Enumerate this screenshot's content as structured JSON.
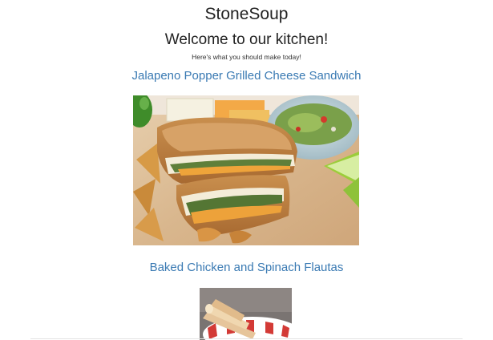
{
  "site": {
    "title": "StoneSoup",
    "welcome": "Welcome to our kitchen!",
    "tagline": "Here's what you should make today!"
  },
  "recipes": [
    {
      "title": "Jalapeno Popper Grilled Cheese Sandwich",
      "image_subject": "grilled cheese sandwich halves with jalapeno and guacamole"
    },
    {
      "title": "Baked Chicken and Spinach Flautas",
      "image_subject": "rolled flautas on a red striped plate"
    }
  ],
  "colors": {
    "link": "#3a7ab3",
    "heading": "#222222",
    "background": "#ffffff"
  }
}
